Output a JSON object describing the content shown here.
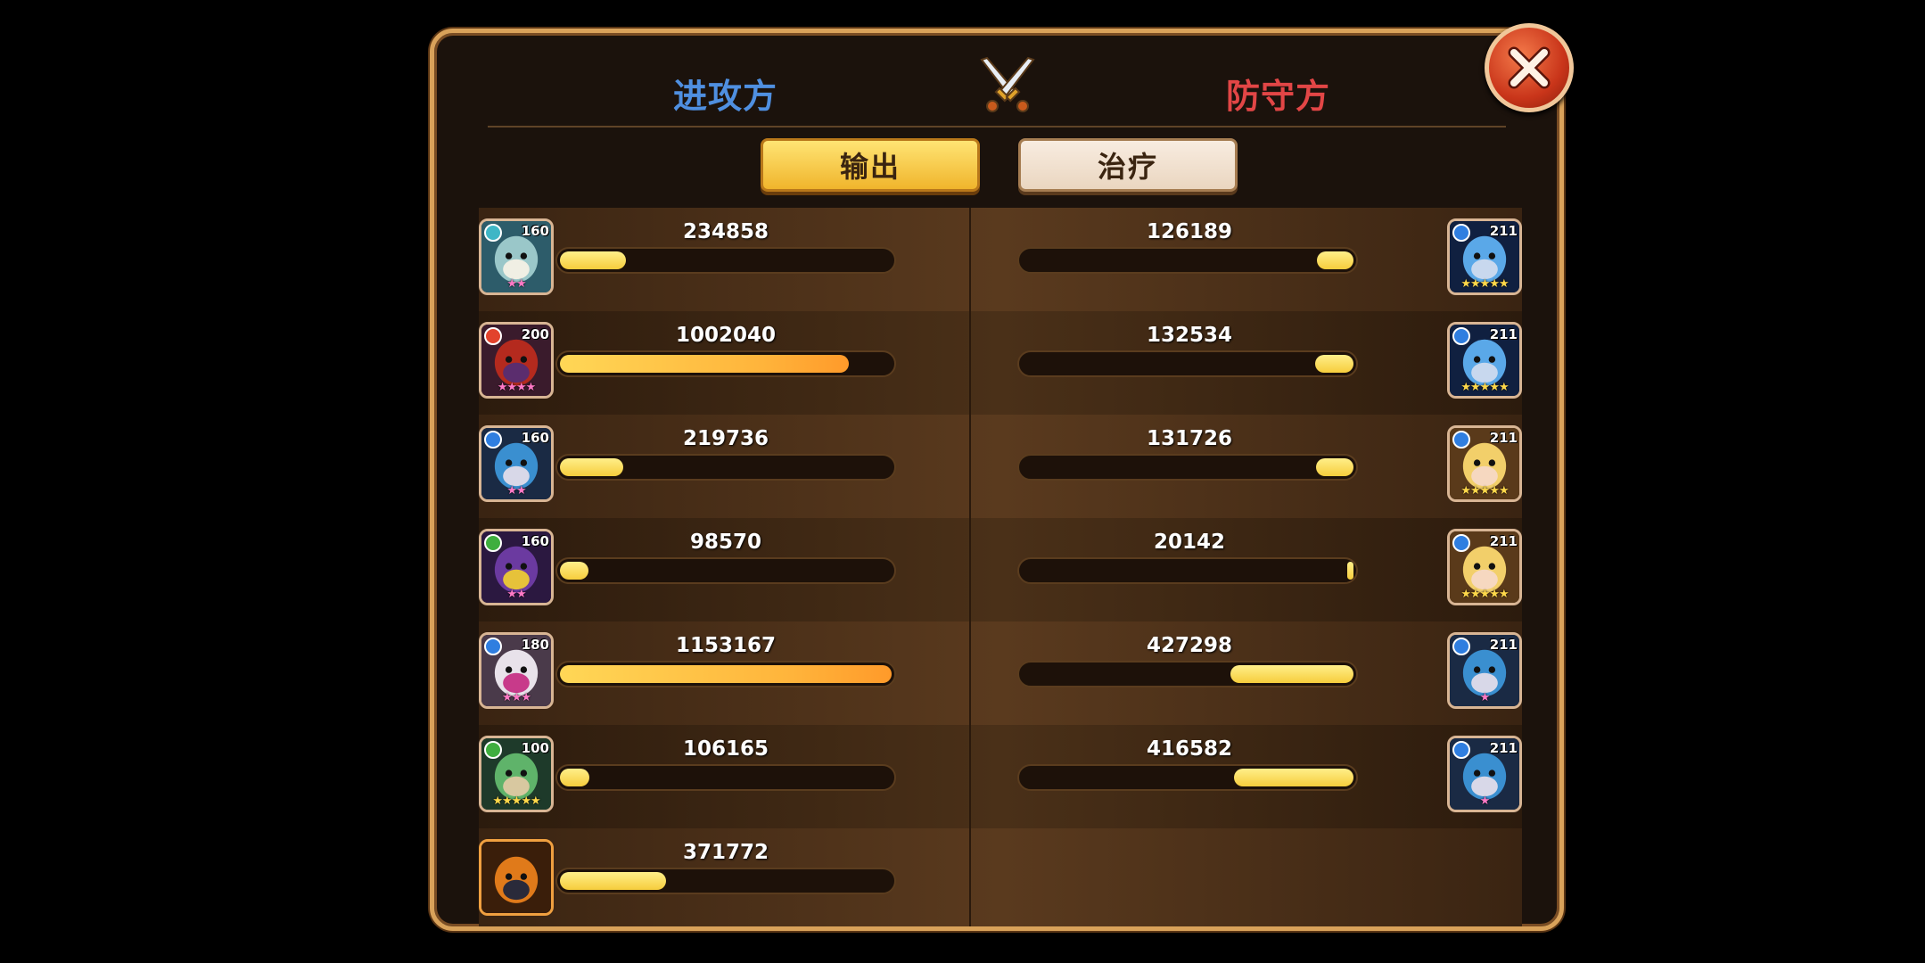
{
  "header": {
    "attacker_label": "进攻方",
    "defender_label": "防守方"
  },
  "tabs": {
    "output": "输出",
    "heal": "治疗"
  },
  "colors": {
    "attacker": "#4f8fe0",
    "defender": "#e24646",
    "bar_fill": "#f6cd3c",
    "bar_fill_hot": "#ff9a2a"
  },
  "max_value": 1153167,
  "attackers": [
    {
      "level": "160",
      "value": "234858",
      "ratio": 0.2,
      "stars": "★★",
      "star_color": "#ff79c6",
      "elem": "#3fb6c6",
      "portrait": "beast-teal"
    },
    {
      "level": "200",
      "value": "1002040",
      "ratio": 0.87,
      "stars": "★★★★",
      "star_color": "#ff79c6",
      "elem": "#e2432c",
      "portrait": "demon-red"
    },
    {
      "level": "160",
      "value": "219736",
      "ratio": 0.19,
      "stars": "★★",
      "star_color": "#ff79c6",
      "elem": "#2f7ee0",
      "portrait": "knight-blue"
    },
    {
      "level": "160",
      "value": "98570",
      "ratio": 0.085,
      "stars": "★★",
      "star_color": "#ff79c6",
      "elem": "#3fae3f",
      "portrait": "mage-purple"
    },
    {
      "level": "180",
      "value": "1153167",
      "ratio": 1.0,
      "stars": "★★★",
      "star_color": "#ff79c6",
      "elem": "#2f7ee0",
      "portrait": "girl-white"
    },
    {
      "level": "100",
      "value": "106165",
      "ratio": 0.09,
      "stars": "★★★★★",
      "star_color": "#ffd84a",
      "elem": "#3fae3f",
      "portrait": "elf-green"
    },
    {
      "level": "",
      "value": "371772",
      "ratio": 0.32,
      "stars": "",
      "star_color": "#ffd84a",
      "elem": "",
      "portrait": "golem-orange"
    }
  ],
  "defenders": [
    {
      "level": "211",
      "value": "126189",
      "ratio": 0.11,
      "stars": "★★★★★",
      "star_color": "#ffd84a",
      "elem": "#2f7ee0",
      "portrait": "paladin-blue"
    },
    {
      "level": "211",
      "value": "132534",
      "ratio": 0.115,
      "stars": "★★★★★",
      "star_color": "#ffd84a",
      "elem": "#2f7ee0",
      "portrait": "paladin-blue"
    },
    {
      "level": "211",
      "value": "131726",
      "ratio": 0.114,
      "stars": "★★★★★",
      "star_color": "#ffd84a",
      "elem": "#2f7ee0",
      "portrait": "girl-blonde"
    },
    {
      "level": "211",
      "value": "20142",
      "ratio": 0.018,
      "stars": "★★★★★",
      "star_color": "#ffd84a",
      "elem": "#2f7ee0",
      "portrait": "girl-blonde"
    },
    {
      "level": "211",
      "value": "427298",
      "ratio": 0.37,
      "stars": "★",
      "star_color": "#ff79c6",
      "elem": "#2f7ee0",
      "portrait": "knight-blue"
    },
    {
      "level": "211",
      "value": "416582",
      "ratio": 0.36,
      "stars": "★",
      "star_color": "#ff79c6",
      "elem": "#2f7ee0",
      "portrait": "knight-blue"
    }
  ]
}
